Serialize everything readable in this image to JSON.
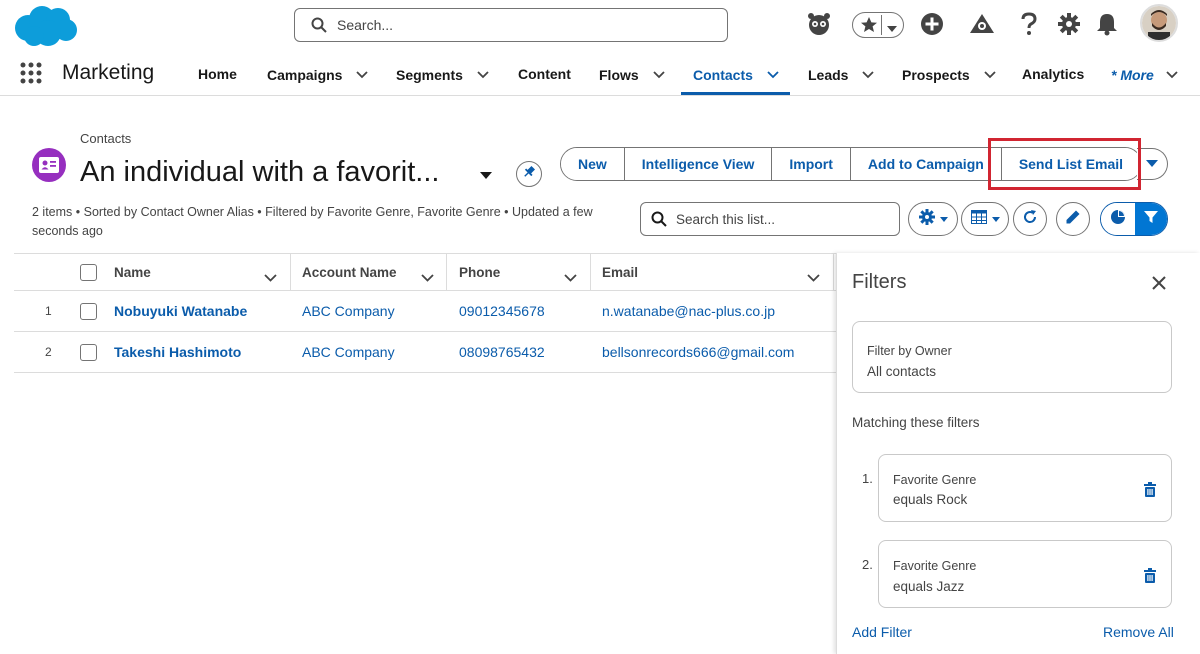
{
  "header": {
    "search_placeholder": "Search...",
    "icons": [
      "einstein-icon",
      "favorites-star-icon",
      "add-icon",
      "trailhead-icon",
      "help-icon",
      "setup-gear-icon",
      "notifications-bell-icon",
      "user-avatar"
    ]
  },
  "nav": {
    "app_name": "Marketing",
    "items": [
      {
        "label": "Home",
        "has_menu": false
      },
      {
        "label": "Campaigns",
        "has_menu": true
      },
      {
        "label": "Segments",
        "has_menu": true
      },
      {
        "label": "Content",
        "has_menu": false
      },
      {
        "label": "Flows",
        "has_menu": true
      },
      {
        "label": "Contacts",
        "has_menu": true,
        "active": true
      },
      {
        "label": "Leads",
        "has_menu": true
      },
      {
        "label": "Prospects",
        "has_menu": true
      },
      {
        "label": "Analytics",
        "has_menu": false
      }
    ],
    "more_label": "* More"
  },
  "list_view": {
    "breadcrumb": "Contacts",
    "title": "An individual with a favorit...",
    "meta": "2 items • Sorted by Contact Owner Alias • Filtered by Favorite Genre, Favorite Genre • Updated a few seconds ago",
    "actions": [
      "New",
      "Intelligence View",
      "Import",
      "Add to Campaign",
      "Send List Email"
    ],
    "highlighted_action": "Send List Email",
    "search_placeholder": "Search this list...",
    "columns": [
      "Name",
      "Account Name",
      "Phone",
      "Email"
    ],
    "rows": [
      {
        "num": "1",
        "name": "Nobuyuki Watanabe",
        "account": "ABC Company",
        "phone": "09012345678",
        "email": "n.watanabe@nac-plus.co.jp"
      },
      {
        "num": "2",
        "name": "Takeshi Hashimoto",
        "account": "ABC Company",
        "phone": "08098765432",
        "email": "bellsonrecords666@gmail.com"
      }
    ]
  },
  "filters": {
    "title": "Filters",
    "owner_label": "Filter by Owner",
    "owner_value": "All contacts",
    "matching_label": "Matching these filters",
    "items": [
      {
        "num": "1.",
        "field": "Favorite Genre",
        "condition": "equals Rock"
      },
      {
        "num": "2.",
        "field": "Favorite Genre",
        "condition": "equals Jazz"
      }
    ],
    "add_filter": "Add Filter",
    "remove_all": "Remove All"
  },
  "colors": {
    "brand_blue": "#0b5cab",
    "salesforce_cloud": "#0d9dda",
    "contact_icon": "#962fbf",
    "highlight": "#d12531"
  }
}
